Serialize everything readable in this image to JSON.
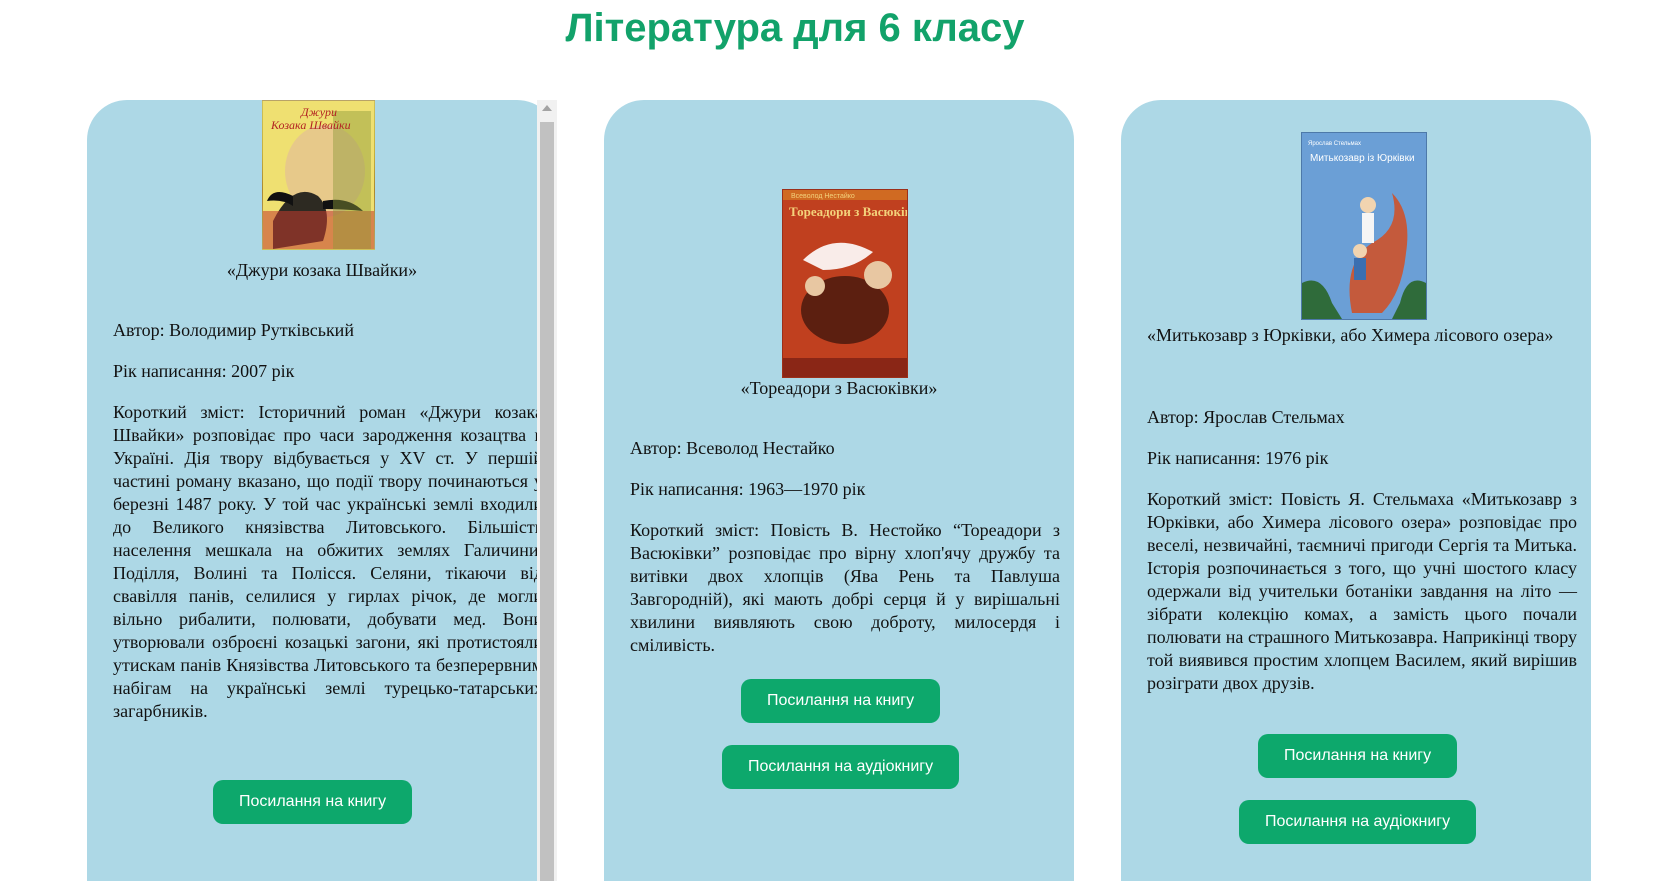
{
  "page": {
    "title": "Література для 6 класу"
  },
  "books": [
    {
      "title": "«Джури козака Швайки»",
      "author": "Автор: Володимир Рутківський",
      "year": "Рік написання: 2007 рік",
      "summary": "Короткий зміст: Історичний роман «Джури козака Швайки» розповідає про часи зародження козацтва в Україні. Дія твору відбувається у XV ст. У першій частині роману вказано, що події твору починаються у березні 1487 року. У той час українські землі входили до Великого князівства Литовського. Більшість населення мешкала на обжитих землях Галичини, Поділля, Волині та Полісся. Селяни, тікаючи від свавілля панів, селилися у гирлах річок, де могли вільно рибалити, полювати, добувати мед. Вони утворювали озброєні козацькі загони, які протистояли утискам панів Князівства Литовського та безперервним набігам на українські землі турецько-татарських загарбників.",
      "book_button": "Посилання на книгу",
      "cover_text_top": "Джури",
      "cover_text_mid": "Козака Швайки"
    },
    {
      "title": "«Тореадори з Васюківки»",
      "author": "Автор: Всеволод Нестайко",
      "year": "Рік написання: 1963—1970 рік",
      "summary": "Короткий зміст: Повість В. Нестойко “Тореадори з Васюківки” розповідає про вірну хлоп'ячу дружбу та витівки двох хлопців (Ява Рень та Павлуша Завгородній), які мають добрі серця й у вирішальні хвилини виявляють свою доброту, милосердя і сміливість.",
      "book_button": "Посилання на книгу",
      "audio_button": "Посилання на аудіокнигу",
      "cover_text_top": "Всеволод Нестайко",
      "cover_text_mid": "Тореадори з Васюківки"
    },
    {
      "title": "«Митькозавр з Юрківки, або Химера лісового озера»",
      "author": "Автор: Ярослав Стельмах",
      "year": "Рік написання: 1976 рік",
      "summary": "Короткий зміст: Повість Я. Стельмаха «Митькозавр з Юрківки, або Химера лісового озера» розповідає про веселі, незвичайні, таємничі пригоди Сергія та Митька. Історія розпочинається з того, що учні шостого класу одержали від учительки ботаніки завдання на літо — зібрати колекцію комах, а замість цього почали полювати на страшного Митькозавра. Наприкінці твору той виявився простим хлопцем Василем, який вирішив розіграти двох друзів.",
      "book_button": "Посилання на книгу",
      "audio_button": "Посилання на аудіокнигу",
      "cover_text_top": "Ярослав Стельмах",
      "cover_text_mid": "Митькозавр із Юрківки"
    }
  ],
  "colors": {
    "accent": "#12a26a",
    "button": "#0da86c",
    "card_bg": "#add8e6"
  }
}
